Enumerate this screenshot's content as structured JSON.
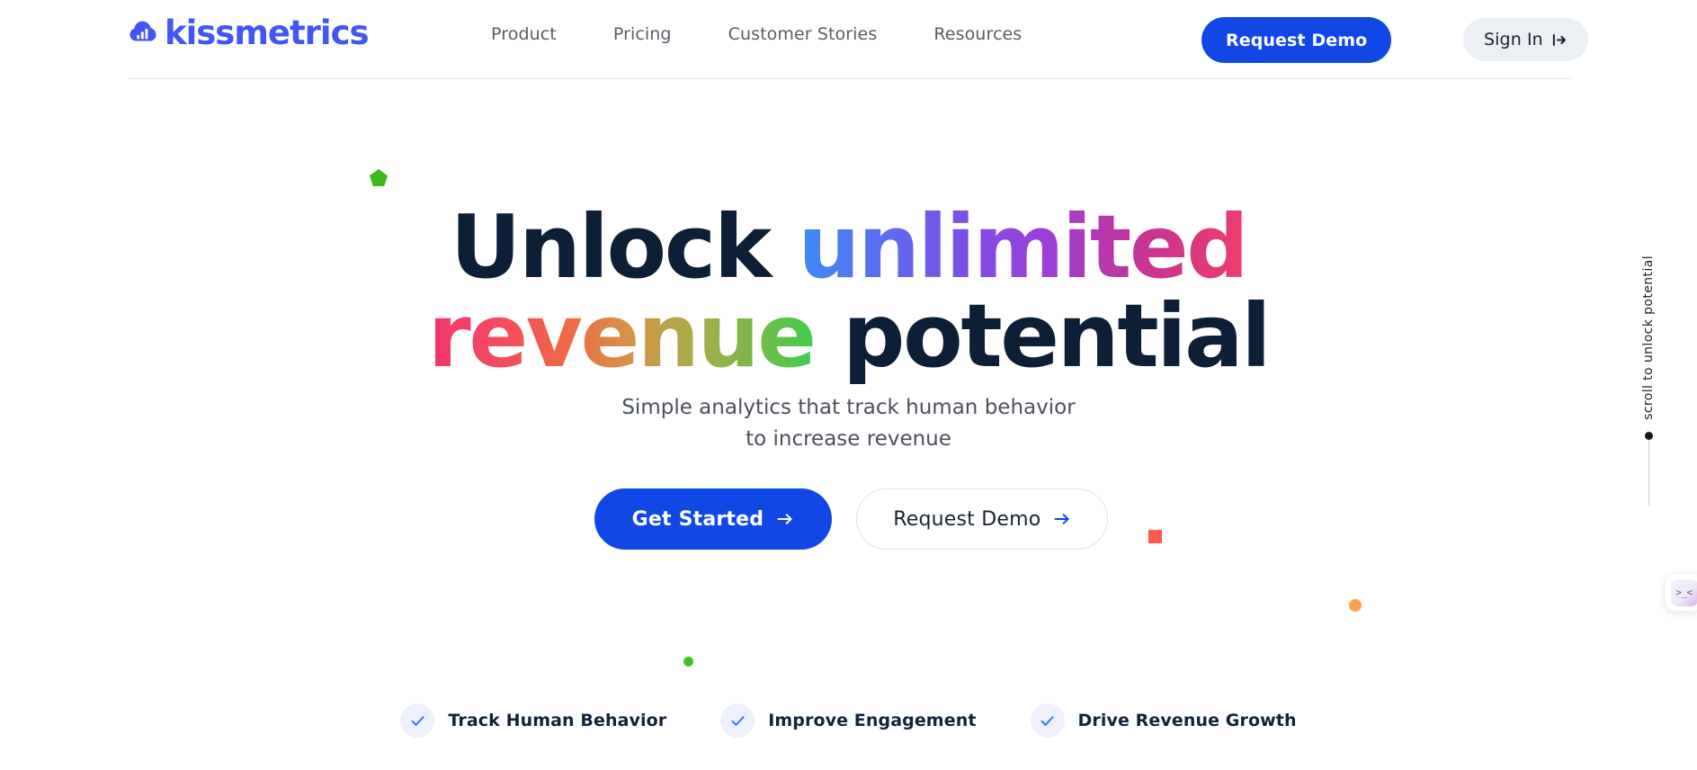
{
  "brand": {
    "name": "kissmetrics",
    "logo_icon": "bar-chart-cloud-icon",
    "color": "#4255f5"
  },
  "header": {
    "nav": [
      {
        "label": "Product"
      },
      {
        "label": "Pricing"
      },
      {
        "label": "Customer Stories"
      },
      {
        "label": "Resources"
      }
    ],
    "request_demo_label": "Request Demo",
    "sign_in_label": "Sign In",
    "sign_in_icon": "login-arrow-icon",
    "primary_color": "#1047e5",
    "sign_in_bg": "#eceff4"
  },
  "hero": {
    "headline": {
      "line1_plain": "Unlock ",
      "line1_gradient": "unlimited",
      "line2_gradient": "revenue",
      "line2_plain": " potential",
      "plain_color": "#0d1f36"
    },
    "subhead": "Simple analytics that track human behavior to increase revenue",
    "cta_primary": {
      "label": "Get Started",
      "icon": "arrow-right-icon"
    },
    "cta_secondary": {
      "label": "Request Demo",
      "icon": "arrow-right-icon"
    },
    "features": [
      {
        "label": "Track Human Behavior",
        "icon": "check-icon"
      },
      {
        "label": "Improve Engagement",
        "icon": "check-icon"
      },
      {
        "label": "Drive Revenue Growth",
        "icon": "check-icon"
      }
    ]
  },
  "scroll_hint": {
    "text": "scroll to unlock potential"
  },
  "float_widget": {
    "face": ">_<"
  },
  "decorations": {
    "pentagon_color": "#3eb91a",
    "square_color": "#fb5b4c",
    "dot_orange_color": "#ffa14f",
    "dot_green_color": "#3ec421"
  }
}
